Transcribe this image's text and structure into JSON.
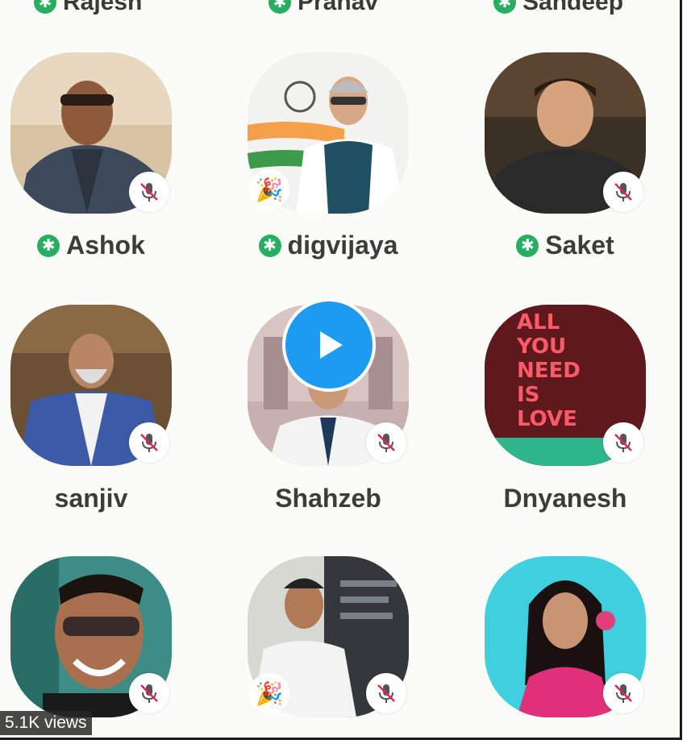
{
  "top_row": [
    {
      "name": "Rajesh",
      "moderator": true
    },
    {
      "name": "Pranav",
      "moderator": true
    },
    {
      "name": "Sandeep",
      "moderator": true
    }
  ],
  "speakers": [
    {
      "name": "Ashok",
      "moderator": true,
      "muted": true,
      "avatar": "man-glasses-jacket-photo"
    },
    {
      "name": "digvijaya",
      "moderator": true,
      "muted": false,
      "reaction": "🎉",
      "avatar": "man-vest-flag-photo"
    },
    {
      "name": "Saket",
      "moderator": true,
      "muted": true,
      "avatar": "man-smiling-dark-shirt-photo"
    },
    {
      "name": "sanjiv",
      "moderator": false,
      "muted": true,
      "avatar": "man-blue-blazer-photo"
    },
    {
      "name": "Shahzeb",
      "moderator": false,
      "muted": true,
      "avatar": "man-white-coat-photo"
    },
    {
      "name": "Dnyanesh",
      "moderator": false,
      "muted": true,
      "avatar": "neon-sign-photo"
    },
    {
      "name": "",
      "moderator": false,
      "muted": true,
      "avatar": "man-sunglasses-photo"
    },
    {
      "name": "",
      "moderator": false,
      "muted": true,
      "reaction": "🎉",
      "avatar": "man-white-shirt-photo"
    },
    {
      "name": "",
      "moderator": false,
      "muted": true,
      "avatar": "woman-flower-cyan-photo"
    }
  ],
  "video": {
    "views_label": "5.1K views",
    "play_icon": "play-icon"
  },
  "colors": {
    "moderator_badge": "#27ae60",
    "play_button": "#1d9bf0",
    "name_text": "#3c3c3c"
  }
}
